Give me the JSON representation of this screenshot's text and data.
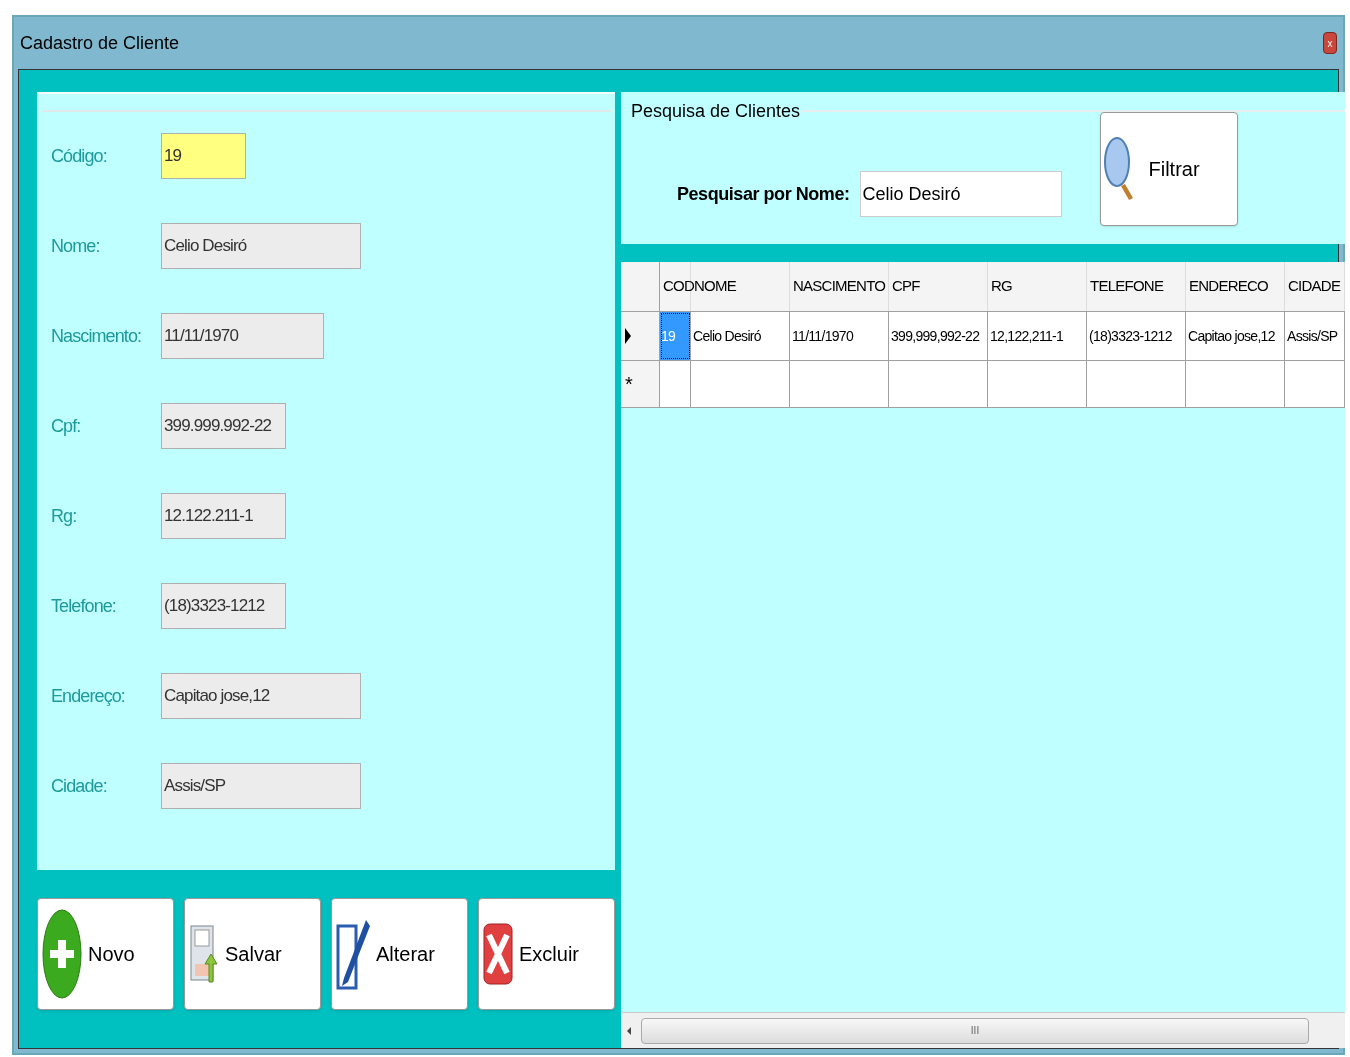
{
  "window": {
    "title": "Cadastro de Cliente",
    "close_label": "x"
  },
  "form": {
    "fields": [
      {
        "label": "Código:",
        "value": "19",
        "highlighted": true
      },
      {
        "label": "Nome:",
        "value": "Celio Desiró",
        "highlighted": false
      },
      {
        "label": "Nascimento:",
        "value": "11/11/1970",
        "highlighted": false
      },
      {
        "label": "Cpf:",
        "value": "399.999.992-22",
        "highlighted": false
      },
      {
        "label": "Rg:",
        "value": "12.122.211-1",
        "highlighted": false
      },
      {
        "label": "Telefone:",
        "value": "(18)3323-1212",
        "highlighted": false
      },
      {
        "label": "Endereço:",
        "value": "Capitao jose,12",
        "highlighted": false
      },
      {
        "label": "Cidade:",
        "value": "Assis/SP",
        "highlighted": false
      }
    ]
  },
  "actions": [
    {
      "label": "Novo",
      "kind": "add"
    },
    {
      "label": "Salvar",
      "kind": "save"
    },
    {
      "label": "Alterar",
      "kind": "edit"
    },
    {
      "label": "Excluir",
      "kind": "delete"
    }
  ],
  "search": {
    "title": "Pesquisa de Clientes",
    "label": "Pesquisar por Nome:",
    "value": "Celio Desiró",
    "button": "Filtrar"
  },
  "grid": {
    "columns": [
      "COD",
      "NOME",
      "NASCIMENTO",
      "CPF",
      "RG",
      "TELEFONE",
      "ENDERECO",
      "CIDADE"
    ],
    "rows": [
      {
        "selected": true,
        "cells": [
          {
            "text": "19",
            "selected": true
          },
          {
            "text": "Celio Desiró",
            "selected": false
          },
          {
            "text": "11/11/1970",
            "selected": false
          },
          {
            "text": "399,999,992-22",
            "selected": false
          },
          {
            "text": "12,122,211-1",
            "selected": false
          },
          {
            "text": "(18)3323-1212",
            "selected": false
          },
          {
            "text": "Capitao jose,12",
            "selected": false
          },
          {
            "text": "Assis/SP",
            "selected": false
          }
        ]
      }
    ],
    "new_row_marker": "*",
    "scrollbar_grip": "III"
  }
}
